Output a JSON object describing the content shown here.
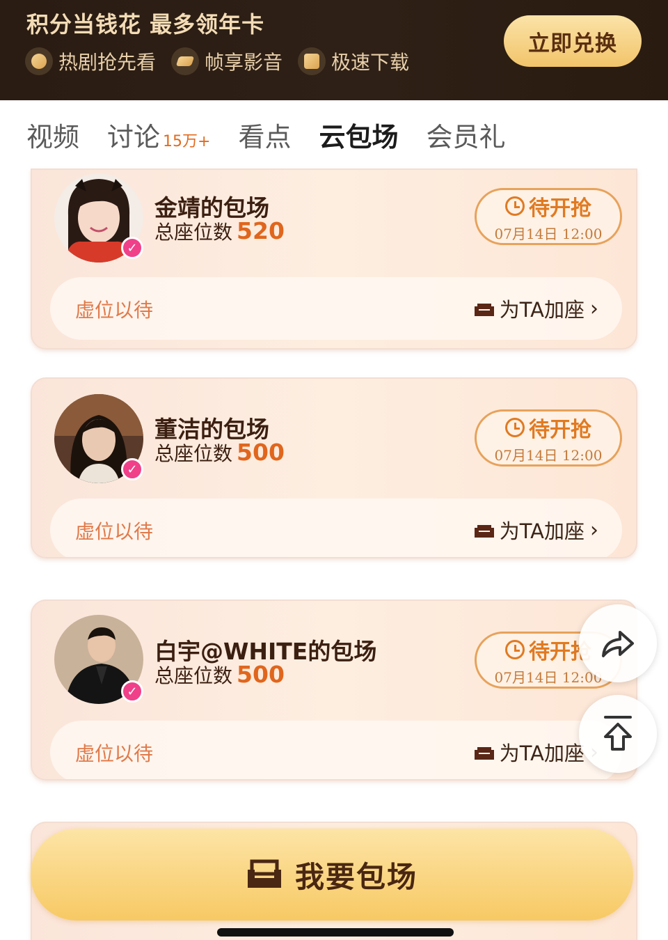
{
  "banner": {
    "title": "积分当钱花 最多领年卡",
    "perks": [
      {
        "label": "热剧抢先看",
        "icon": "smiley-icon"
      },
      {
        "label": "帧享影音",
        "icon": "film-icon"
      },
      {
        "label": "极速下载",
        "icon": "download-icon"
      }
    ],
    "redeem_label": "立即兑换"
  },
  "tabs": [
    {
      "label": "视频"
    },
    {
      "label": "讨论",
      "badge": "15万+"
    },
    {
      "label": "看点"
    },
    {
      "label": "云包场",
      "active": true
    },
    {
      "label": "会员礼"
    }
  ],
  "cards": [
    {
      "title": "金靖的包场",
      "seat_prefix": "总座位数",
      "seats": "520",
      "status": "待开抢",
      "time": "07月14日 12:00",
      "placeholder": "虚位以待",
      "add_seat": "为TA加座"
    },
    {
      "title": "董洁的包场",
      "seat_prefix": "总座位数",
      "seats": "500",
      "status": "待开抢",
      "time": "07月14日 12:00",
      "placeholder": "虚位以待",
      "add_seat": "为TA加座"
    },
    {
      "title": "白宇@WHITE的包场",
      "seat_prefix": "总座位数",
      "seats": "500",
      "status": "待开抢",
      "time": "07月14日 12:00",
      "placeholder": "虚位以待",
      "add_seat": "为TA加座"
    }
  ],
  "cta": {
    "label": "我要包场"
  },
  "colors": {
    "accent_orange": "#e0661d",
    "banner_bg": "#2a1c12",
    "gold": "#f2c46a"
  }
}
